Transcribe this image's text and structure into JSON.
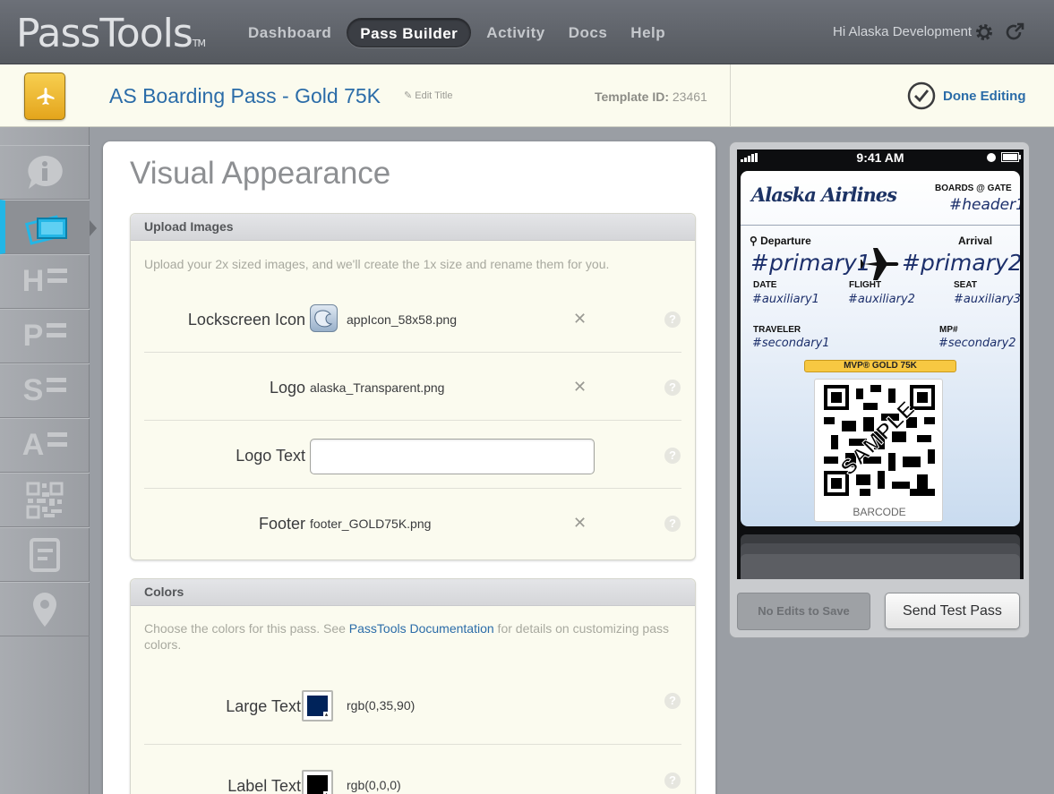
{
  "app": {
    "brand": "PassTools",
    "trademark": "TM",
    "nav": [
      "Dashboard",
      "Pass Builder",
      "Activity",
      "Docs",
      "Help"
    ],
    "active_nav": "Pass Builder",
    "greeting": "Hi Alaska Development",
    "icons": [
      "gear-icon",
      "logout-icon"
    ]
  },
  "titlebar": {
    "title": "AS Boarding Pass - Gold 75K",
    "edit_title": "Edit Title",
    "template_id_label": "Template ID:",
    "template_id": "23461",
    "done_label": "Done Editing"
  },
  "sidebar": {
    "items": [
      "info-icon",
      "visual-appearance-icon",
      "header-fields-icon",
      "primary-fields-icon",
      "secondary-fields-icon",
      "auxiliary-fields-icon",
      "barcode-icon",
      "back-fields-icon",
      "location-icon"
    ],
    "letters": [
      "H",
      "P",
      "S",
      "A"
    ],
    "active_index": 1
  },
  "main": {
    "heading": "Visual Appearance",
    "upload": {
      "title": "Upload Images",
      "description": "Upload your 2x sized images, and we'll create the 1x size and rename them for you.",
      "rows": [
        {
          "label": "Lockscreen Icon",
          "file": "appIcon_58x58.png"
        },
        {
          "label": "Logo",
          "file": "alaska_Transparent.png"
        },
        {
          "label": "Logo Text",
          "value": ""
        },
        {
          "label": "Footer",
          "file": "footer_GOLD75K.png"
        }
      ],
      "remove_glyph": "✕",
      "help_glyph": "?"
    },
    "colors": {
      "title": "Colors",
      "description_before": "Choose the colors for this pass. See ",
      "description_link": "PassTools Documentation",
      "description_after": " for details on customizing pass colors.",
      "rows": [
        {
          "label": "Large Text",
          "value": "rgb(0,35,90)",
          "swatch": "#00235a"
        },
        {
          "label": "Label Text",
          "value": "rgb(0,0,0)",
          "swatch": "#000000"
        }
      ]
    }
  },
  "preview": {
    "status_time": "9:41 AM",
    "airline": "Alaska Airlines",
    "boards_label": "BOARDS @ GATE",
    "header1": "#header1",
    "departure_label": "Departure",
    "arrival_label": "Arrival",
    "primary1": "#primary1",
    "primary2": "#primary2",
    "aux": [
      {
        "label": "DATE",
        "value": "#auxiliary1"
      },
      {
        "label": "FLIGHT",
        "value": "#auxiliary2"
      },
      {
        "label": "SEAT",
        "value": "#auxiliary3"
      }
    ],
    "secondary": [
      {
        "label": "TRAVELER",
        "value": "#secondary1"
      },
      {
        "label": "MP#",
        "value": "#secondary2"
      }
    ],
    "status_strip": "MVP® GOLD 75K",
    "barcode_watermark": "SAMPLE",
    "barcode_caption": "BARCODE",
    "no_edits_label": "No Edits to Save",
    "send_label": "Send Test Pass"
  }
}
